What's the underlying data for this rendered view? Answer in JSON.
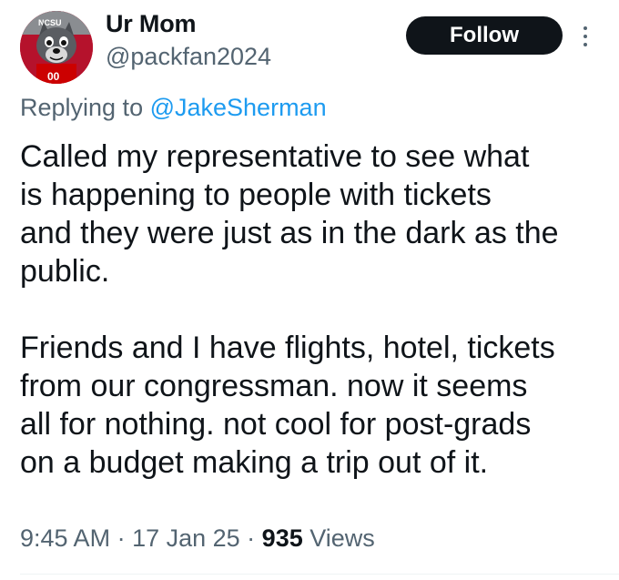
{
  "author": {
    "display_name": "Ur Mom",
    "handle": "@packfan2024"
  },
  "actions": {
    "follow_label": "Follow"
  },
  "reply": {
    "prefix": "Replying to ",
    "mention": "@JakeSherman"
  },
  "tweet": {
    "paragraph_1": "Called my representative to see what\nis happening to people with tickets\nand they were just as in the dark as the\npublic.",
    "paragraph_2": "Friends and I have flights, hotel, tickets\nfrom our congressman. now it seems\nall for nothing. not cool for post-grads\non a budget making a trip out of it."
  },
  "meta": {
    "time": "9:45 AM",
    "separator": " · ",
    "date": "17 Jan 25",
    "views_count": "935",
    "views_label": " Views"
  },
  "colors": {
    "text_primary": "#0f1419",
    "text_secondary": "#536471",
    "link": "#1d9bf0",
    "follow_bg": "#0f1419"
  },
  "icons": {
    "more": "more-vertical-icon",
    "avatar": "wolf-mascot-avatar"
  }
}
